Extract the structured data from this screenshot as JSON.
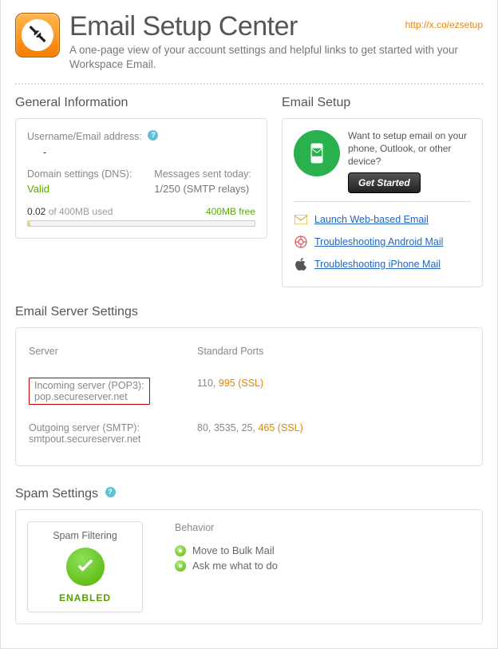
{
  "header": {
    "title": "Email Setup Center",
    "subtitle": "A one-page view of your account settings and helpful links to get started with your Workspace Email.",
    "top_link_text": "http://x.co/ezsetup"
  },
  "general_info": {
    "section_title": "General Information",
    "username_label": "Username/Email address:",
    "username_value": "-",
    "dns_label": "Domain settings (DNS):",
    "dns_value": "Valid",
    "sent_label": "Messages sent today:",
    "sent_value": "1/250 (SMTP relays)",
    "storage_used": "0.02",
    "storage_cap_text": " of 400MB used",
    "storage_free": "400MB free"
  },
  "email_setup": {
    "section_title": "Email Setup",
    "prompt": "Want to setup email on your phone, Outlook, or other device?",
    "button_label": "Get Started",
    "links": [
      {
        "label": "Launch Web-based Email"
      },
      {
        "label": "Troubleshooting Android Mail"
      },
      {
        "label": "Troubleshooting iPhone Mail"
      }
    ]
  },
  "server_settings": {
    "section_title": "Email Server Settings",
    "col_server": "Server",
    "col_ports": "Standard Ports",
    "rows": [
      {
        "name": "Incoming server (POP3):",
        "host": "pop.secureserver.net",
        "port_plain": "110, ",
        "port_ssl": "995 (SSL)"
      },
      {
        "name": "Outgoing server (SMTP):",
        "host": "smtpout.secureserver.net",
        "port_plain": "80, 3535, 25, ",
        "port_ssl": "465 (SSL)"
      }
    ]
  },
  "spam": {
    "section_title": "Spam Settings",
    "card_title": "Spam Filtering",
    "card_status": "ENABLED",
    "behavior_title": "Behavior",
    "options": [
      "Move to Bulk Mail",
      "Ask me what to do"
    ]
  }
}
